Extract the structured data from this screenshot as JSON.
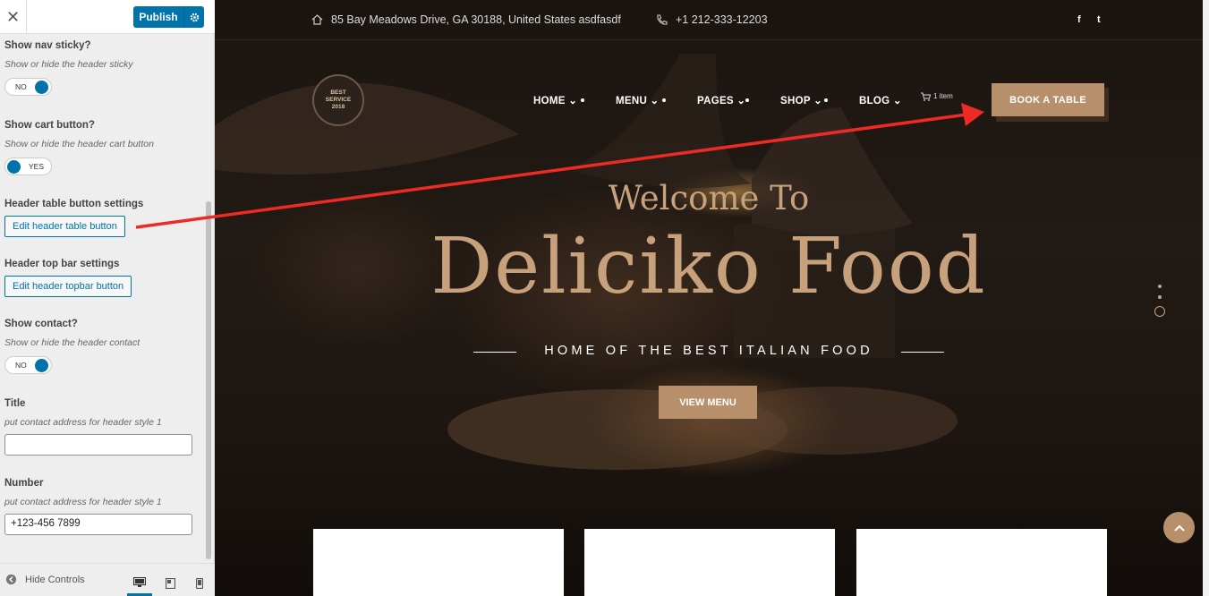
{
  "customizer": {
    "close_glyph": "✕",
    "publish_label": "Publish",
    "settings": [
      {
        "title": "Show nav sticky?",
        "desc": "Show or hide the header sticky",
        "toggle": "NO"
      },
      {
        "title": "Show cart button?",
        "desc": "Show or hide the header cart button",
        "toggle": "YES"
      },
      {
        "title": "Header table button settings",
        "button": "Edit header table button"
      },
      {
        "title": "Header top bar settings",
        "button": "Edit header topbar button"
      },
      {
        "title": "Show contact?",
        "desc": "Show or hide the header contact",
        "toggle": "NO"
      },
      {
        "title": "Title",
        "desc": "put contact address for header style 1",
        "value": ""
      },
      {
        "title": "Number",
        "desc": "put contact address for header style 1",
        "value": "+123-456 7899"
      }
    ],
    "hide_controls": "Hide Controls",
    "accent": "#0073aa"
  },
  "preview": {
    "address": "85 Bay Meadows Drive, GA 30188, United States asdfasdf",
    "phone": "+1 212-333-12203",
    "social": [
      "f",
      "t"
    ],
    "logo_lines": [
      "BEST",
      "SERVICE",
      "2018"
    ],
    "nav": [
      "HOME",
      "MENU",
      "PAGES",
      "SHOP",
      "BLOG"
    ],
    "cart_text": "1 item",
    "book_label": "BOOK A TABLE",
    "welcome": "Welcome To",
    "title": "Deliciko Food",
    "subtitle": "HOME OF THE BEST ITALIAN FOOD",
    "view_menu": "VIEW MENU",
    "brand_color": "#b78f6b"
  }
}
